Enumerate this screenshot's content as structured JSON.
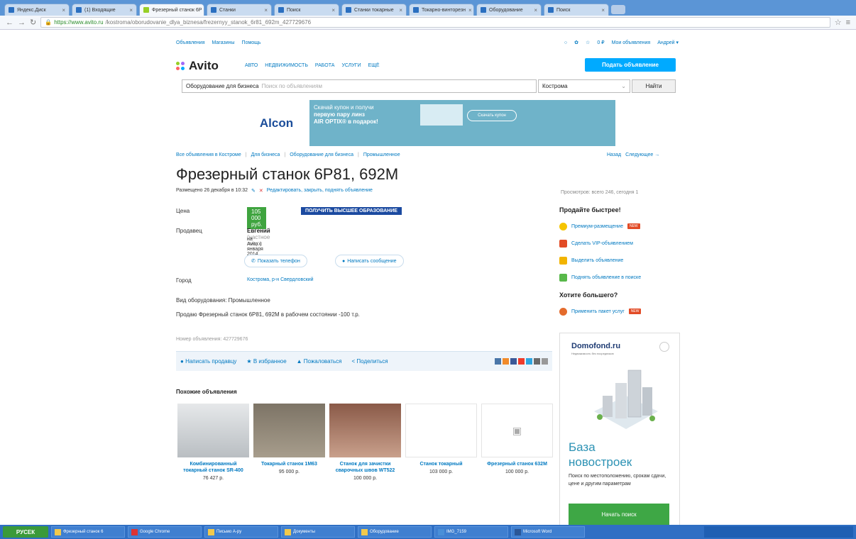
{
  "browser": {
    "tabs": [
      {
        "label": "Яндекс.Диск"
      },
      {
        "label": "(1) Входящие"
      },
      {
        "label": "Фрезерный станок 6Р"
      },
      {
        "label": "Станки"
      },
      {
        "label": "Поиск"
      },
      {
        "label": "Станки токарные"
      },
      {
        "label": "Токарно-винторезн"
      },
      {
        "label": "Оборудование"
      },
      {
        "label": "Поиск"
      }
    ],
    "url_secure": "https://www.avito.ru",
    "url_rest": "/kostroma/oborudovanie_dlya_biznesa/frezernyy_stanok_6r81_692m_427729676"
  },
  "topnav": {
    "left": [
      "Объявления",
      "Магазины",
      "Помощь"
    ],
    "right": [
      "Мои объявления",
      "Андрей ▾"
    ],
    "count": "0 ₽"
  },
  "header": {
    "logo": "Avito",
    "categories": [
      "АВТО",
      "НЕДВИЖИМОСТЬ",
      "РАБОТА",
      "УСЛУГИ",
      "ЕЩЁ"
    ],
    "post_button": "Подать объявление",
    "search_category": "Оборудование для бизнеса",
    "search_placeholder": "Поиск по объявлениям",
    "city": "Кострома",
    "find_button": "Найти"
  },
  "banner": {
    "logo": "Alcon",
    "line1": "Скачай купон и получи",
    "line2": "первую пару линз",
    "line3": "AIR OPTIX® в подарок!",
    "button": "Скачать купон"
  },
  "breadcrumbs": [
    "Все объявления в Костроме",
    "Для бизнеса",
    "Оборудование для бизнеса",
    "Промышленное"
  ],
  "navlinks": [
    "Назад",
    "Следующее →"
  ],
  "listing": {
    "title": "Фрезерный станок 6Р81, 692М",
    "posted": "Размещено 26 декабря в 10:32",
    "edit_links": "Редактировать, закрыть, поднять объявление",
    "views": "Просмотров: всего 246, сегодня 1",
    "price_label": "Цена",
    "price": "105 000 руб.",
    "edu_banner": "ПОЛУЧИТЬ ВЫСШЕЕ ОБРАЗОВАНИЕ",
    "seller_label": "Продавец",
    "seller_name": "Евгений",
    "seller_role": "(частное лицо)",
    "seller_since": "на Avito с января 2014",
    "show_phone": "Показать телефон",
    "write_message": "Написать сообщение",
    "city_label": "Город",
    "city_value": "Кострома, р-н Свердловский",
    "kind": "Вид оборудования: Промышленное",
    "description": "Продаю Фрезерный станок 6Р81, 692М в рабочем состоянии -100 т.р.",
    "ad_number": "Номер объявления: 427729676"
  },
  "actions": [
    "Написать продавцу",
    "В избранное",
    "Пожаловаться",
    "Поделиться"
  ],
  "similar": {
    "title": "Похожие объявления",
    "items": [
      {
        "title": "Комбинированный токарный станок SR-400",
        "price": "76 427 р."
      },
      {
        "title": "Токарный станок 1М63",
        "price": "95 000 р."
      },
      {
        "title": "Станок для зачистки сварочных швов WT522",
        "price": "100 000 р."
      },
      {
        "title": "Станок токарный",
        "price": "103 000 р."
      },
      {
        "title": "Фрезерный станок 632М",
        "price": "100 000 р."
      }
    ]
  },
  "sidebar": {
    "sell_faster": "Продайте быстрее!",
    "sell_items": [
      "Премиум-размещение",
      "Сделать VIP-объявлением",
      "Выделить объявление",
      "Поднять объявление в поиске"
    ],
    "want_more": "Хотите большего?",
    "more_items": [
      "Применить пакет услуг"
    ],
    "new_badge": "NEW"
  },
  "domofond": {
    "logo": "Domofond.ru",
    "sub": "Недвижимость без посредников",
    "big1": "База",
    "big2": "новостроек",
    "text": "Поиск по местоположению, срокам сдачи, цене и другим параметрам",
    "button": "Начать поиск"
  },
  "taskbar": {
    "start": "РУСЕК",
    "items": [
      "Фрезерный станок 6",
      "Google Chrome",
      "Письмо А-ру",
      "Документы",
      "Оборудование",
      "IMG_7159",
      "Microsoft Word"
    ]
  },
  "colors": {
    "brand_blue": "#00aaff",
    "price_green": "#3fa43f",
    "link": "#0079c1"
  }
}
